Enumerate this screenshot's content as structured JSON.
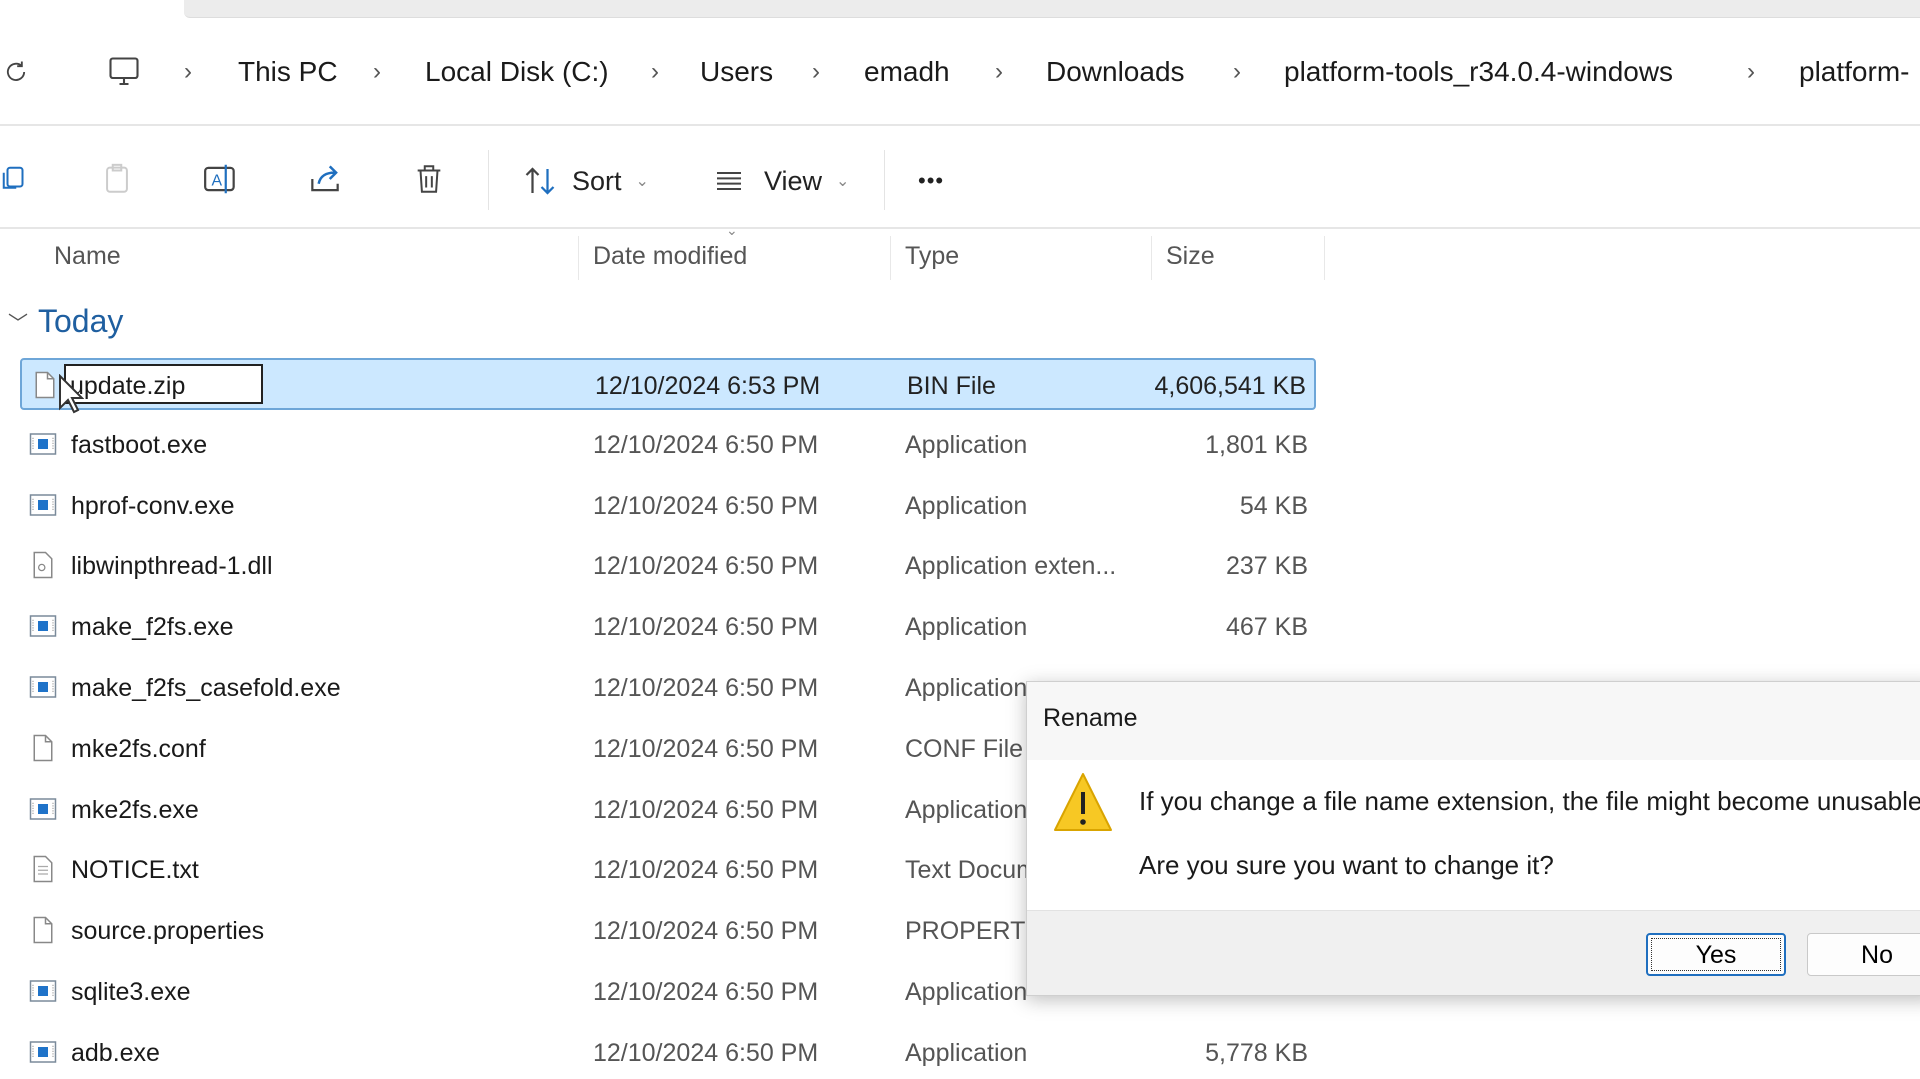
{
  "breadcrumb": [
    "This PC",
    "Local Disk (C:)",
    "Users",
    "emadh",
    "Downloads",
    "platform-tools_r34.0.4-windows",
    "platform-"
  ],
  "toolbar": {
    "sort": "Sort",
    "view": "View",
    "more": "•••"
  },
  "columns": {
    "name": "Name",
    "date": "Date modified",
    "type": "Type",
    "size": "Size"
  },
  "group": "Today",
  "rename_value": "update.zip",
  "files": [
    {
      "name": "update.zip",
      "date": "12/10/2024 6:53 PM",
      "type": "BIN File",
      "size": "4,606,541 KB",
      "icon": "blank-file-icon"
    },
    {
      "name": "fastboot.exe",
      "date": "12/10/2024 6:50 PM",
      "type": "Application",
      "size": "1,801 KB",
      "icon": "application-icon"
    },
    {
      "name": "hprof-conv.exe",
      "date": "12/10/2024 6:50 PM",
      "type": "Application",
      "size": "54 KB",
      "icon": "application-icon"
    },
    {
      "name": "libwinpthread-1.dll",
      "date": "12/10/2024 6:50 PM",
      "type": "Application exten...",
      "size": "237 KB",
      "icon": "dll-file-icon"
    },
    {
      "name": "make_f2fs.exe",
      "date": "12/10/2024 6:50 PM",
      "type": "Application",
      "size": "467 KB",
      "icon": "application-icon"
    },
    {
      "name": "make_f2fs_casefold.exe",
      "date": "12/10/2024 6:50 PM",
      "type": "Application",
      "size": "",
      "icon": "application-icon"
    },
    {
      "name": "mke2fs.conf",
      "date": "12/10/2024 6:50 PM",
      "type": "CONF File",
      "size": "",
      "icon": "blank-file-icon"
    },
    {
      "name": "mke2fs.exe",
      "date": "12/10/2024 6:50 PM",
      "type": "Application",
      "size": "",
      "icon": "application-icon"
    },
    {
      "name": "NOTICE.txt",
      "date": "12/10/2024 6:50 PM",
      "type": "Text Document",
      "size": "",
      "icon": "text-file-icon"
    },
    {
      "name": "source.properties",
      "date": "12/10/2024 6:50 PM",
      "type": "PROPERTIES File",
      "size": "",
      "icon": "blank-file-icon"
    },
    {
      "name": "sqlite3.exe",
      "date": "12/10/2024 6:50 PM",
      "type": "Application",
      "size": "",
      "icon": "application-icon"
    },
    {
      "name": "adb.exe",
      "date": "12/10/2024 6:50 PM",
      "type": "Application",
      "size": "5,778 KB",
      "icon": "application-icon"
    }
  ],
  "dialog": {
    "title": "Rename",
    "message": "If you change a file name extension, the file might become unusable.",
    "question": "Are you sure you want to change it?",
    "yes": "Yes",
    "no": "No"
  },
  "colors": {
    "selection": "#cce8ff",
    "accent": "#1f6fbf",
    "warning": "#f7c824"
  }
}
